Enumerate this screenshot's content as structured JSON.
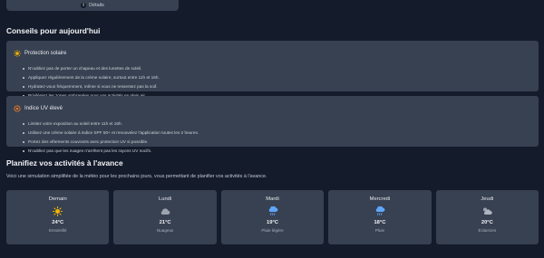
{
  "top_card": {
    "label": "Détails"
  },
  "tips_section": {
    "title": "Conseils pour aujourd'hui",
    "cards": [
      {
        "icon": "sun-icon",
        "title": "Protection solaire",
        "items": [
          "N'oubliez pas de porter un chapeau et des lunettes de soleil.",
          "Appliquez régulièrement de la crème solaire, surtout entre 11h et 16h.",
          "Hydratez-vous fréquemment, même si vous ne ressentez pas la soif.",
          "Privilégiez les zones ombragées pour vos activités en plein air."
        ]
      },
      {
        "icon": "uv-warning-icon",
        "title": "Indice UV élevé",
        "items": [
          "Limitez votre exposition au soleil entre 11h et 16h.",
          "Utilisez une crème solaire à indice SPF 50+ et renouvelez l'application toutes les 2 heures.",
          "Portez des vêtements couvrants avec protection UV si possible.",
          "N'oubliez pas que les nuages n'arrêtent pas les rayons UV nocifs."
        ]
      }
    ]
  },
  "plan_section": {
    "title": "Planifiez vos activités à l'avance",
    "subtitle": "Voici une simulation simplifiée de la météo pour les prochains jours, vous permettant de planifier vos activités à l'avance."
  },
  "forecast": [
    {
      "day": "Demain",
      "icon": "sun-icon",
      "temp": "24°C",
      "condition": "Ensoleillé"
    },
    {
      "day": "Lundi",
      "icon": "cloud-icon",
      "temp": "21°C",
      "condition": "Nuageux"
    },
    {
      "day": "Mardi",
      "icon": "rain-cloud-icon",
      "temp": "19°C",
      "condition": "Pluie légère"
    },
    {
      "day": "Mercredi",
      "icon": "rain-cloud-icon",
      "temp": "18°C",
      "condition": "Pluie"
    },
    {
      "day": "Jeudi",
      "icon": "cloud-sun-icon",
      "temp": "20°C",
      "condition": "Éclaircies"
    }
  ],
  "colors": {
    "background": "#141b2b",
    "card": "#374151",
    "sun": "#f5b301",
    "rain": "#60a5fa",
    "cloud": "#9ca3af",
    "uv": "#ea7a2c"
  }
}
